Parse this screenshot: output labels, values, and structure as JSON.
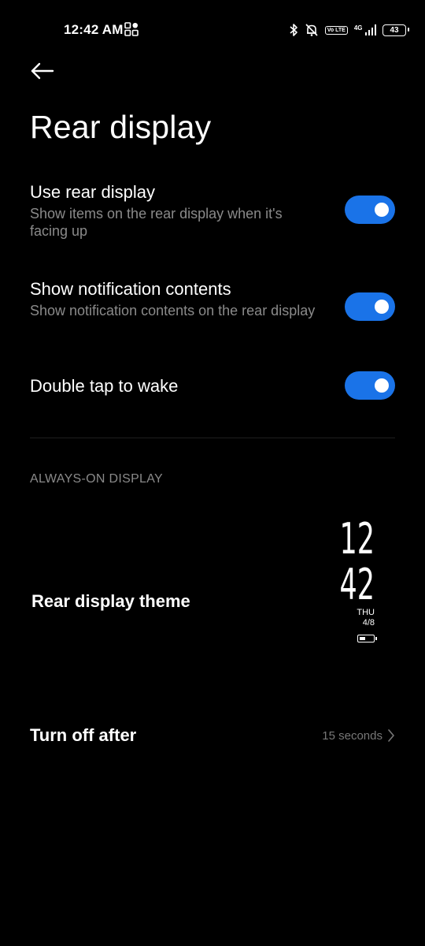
{
  "status_bar": {
    "time": "12:42 AM",
    "icons": [
      "app-grid-icon",
      "bluetooth-icon",
      "ringer-off-icon",
      "volte-icon",
      "signal-icon",
      "battery-icon"
    ],
    "volte_text": "Vo LTE",
    "network": "4G",
    "battery_level": "43"
  },
  "header": {
    "back_icon": "back-arrow-icon",
    "title": "Rear display"
  },
  "settings": [
    {
      "title": "Use rear display",
      "description": "Show items on the rear display when it's facing up",
      "toggle": true
    },
    {
      "title": "Show notification contents",
      "description": "Show notification contents on the rear display",
      "toggle": true
    },
    {
      "title": "Double tap to wake",
      "description": "",
      "toggle": true
    }
  ],
  "section": {
    "header": "ALWAYS-ON DISPLAY"
  },
  "theme": {
    "label": "Rear display theme",
    "preview": {
      "hour": "12",
      "minute": "42",
      "day": "THU",
      "date": "4/8"
    }
  },
  "turn_off": {
    "label": "Turn off after",
    "value": "15 seconds"
  },
  "colors": {
    "background": "#000000",
    "accent": "#1a73e8",
    "secondary_text": "#8a8a8a"
  }
}
